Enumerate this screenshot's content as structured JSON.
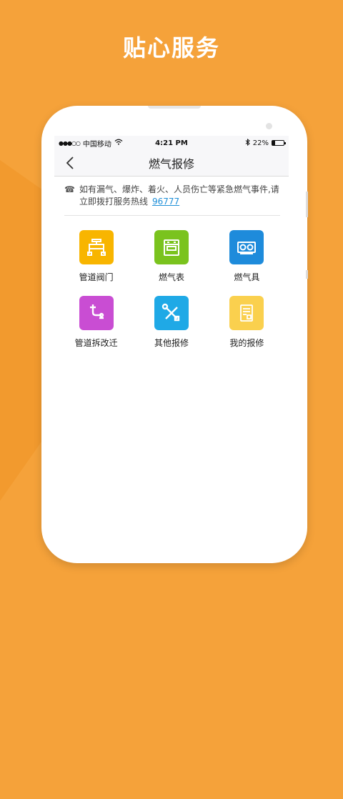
{
  "headline": "贴心服务",
  "status_bar": {
    "signal": "●●●○○",
    "carrier": "中国移动",
    "time": "4:21 PM",
    "battery_percent": "22%",
    "battery_level": 0.22
  },
  "nav": {
    "title": "燃气报修",
    "back_icon": "chevron-left-icon"
  },
  "notice": {
    "icon": "telephone-icon",
    "text": "如有漏气、爆炸、着火、人员伤亡等紧急燃气事件,请立即拨打服务热线",
    "hotline": "96777"
  },
  "services": [
    {
      "label": "管道阀门",
      "icon": "pipe-valve-icon",
      "color": "#F8B500"
    },
    {
      "label": "燃气表",
      "icon": "gas-meter-icon",
      "color": "#7AC31E"
    },
    {
      "label": "燃气具",
      "icon": "gas-stove-icon",
      "color": "#1E8BDB"
    },
    {
      "label": "管道拆改迁",
      "icon": "pipe-relocation-icon",
      "color": "#C94DD3"
    },
    {
      "label": "其他报修",
      "icon": "tools-icon",
      "color": "#1FA9E6"
    },
    {
      "label": "我的报修",
      "icon": "repair-record-icon",
      "color": "#FAD04E"
    }
  ]
}
